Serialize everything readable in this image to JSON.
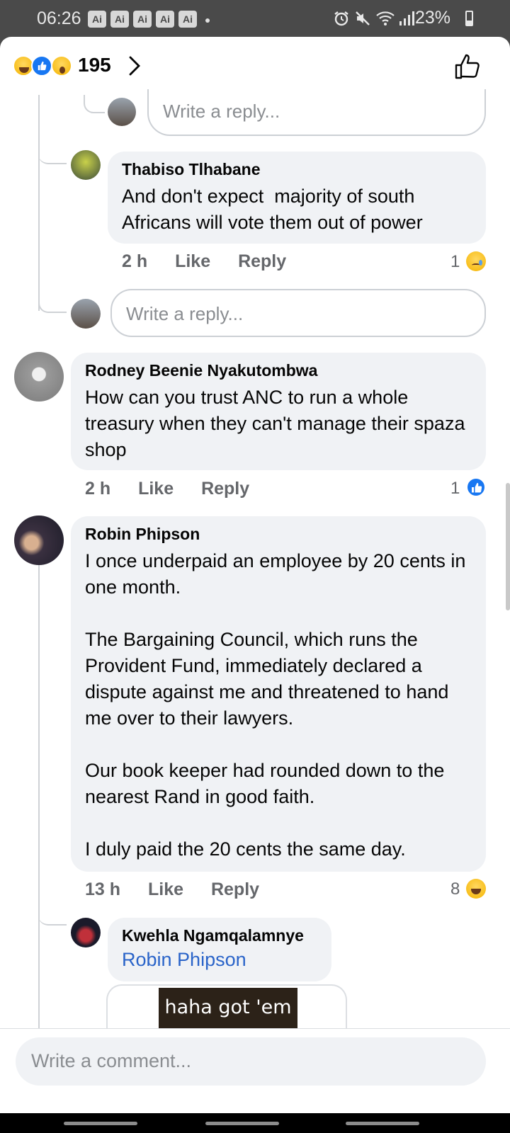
{
  "status_bar": {
    "time": "06:26",
    "ai_badges": [
      "Ai",
      "Ai",
      "Ai",
      "Ai",
      "Ai"
    ],
    "battery": "23%"
  },
  "header": {
    "reactions": [
      "haha-icon",
      "like-icon",
      "wow-icon"
    ],
    "reaction_count": "195"
  },
  "thread": {
    "reply_placeholder_top": "Write a reply...",
    "comment1": {
      "author": "Thabiso Tlhabane",
      "text": "And don't expect  majority of south Africans will vote them out of power",
      "time": "2 h",
      "like": "Like",
      "reply": "Reply",
      "reaction_count": "1",
      "reaction_icon": "sad-icon"
    },
    "reply_placeholder_mid": "Write a reply...",
    "comment2": {
      "author": "Rodney Beenie Nyakutombwa",
      "text": "How can you trust ANC to run a whole treasury when they can't manage their spaza shop",
      "time": "2 h",
      "like": "Like",
      "reply": "Reply",
      "reaction_count": "1",
      "reaction_icon": "like-icon"
    },
    "comment3": {
      "author": "Robin Phipson",
      "text": "I once underpaid an employee by 20 cents in one month.\n\nThe Bargaining Council, which runs the Provident Fund, immediately declared a dispute against me and threatened to hand me over to their lawyers.\n\nOur book keeper had rounded down to the nearest Rand in good faith.\n\nI duly paid the 20 cents the same day.",
      "time": "13 h",
      "like": "Like",
      "reply": "Reply",
      "reaction_count": "8",
      "reaction_icon": "haha-icon"
    },
    "comment4": {
      "author": "Kwehla Ngamqalamnye",
      "mention": "Robin Phipson",
      "gif_caption": "haha got 'em"
    }
  },
  "footer": {
    "comment_placeholder": "Write a comment..."
  },
  "colors": {
    "link": "#2a64c9",
    "like_blue": "#1877f2",
    "bubble": "#f0f2f5"
  }
}
